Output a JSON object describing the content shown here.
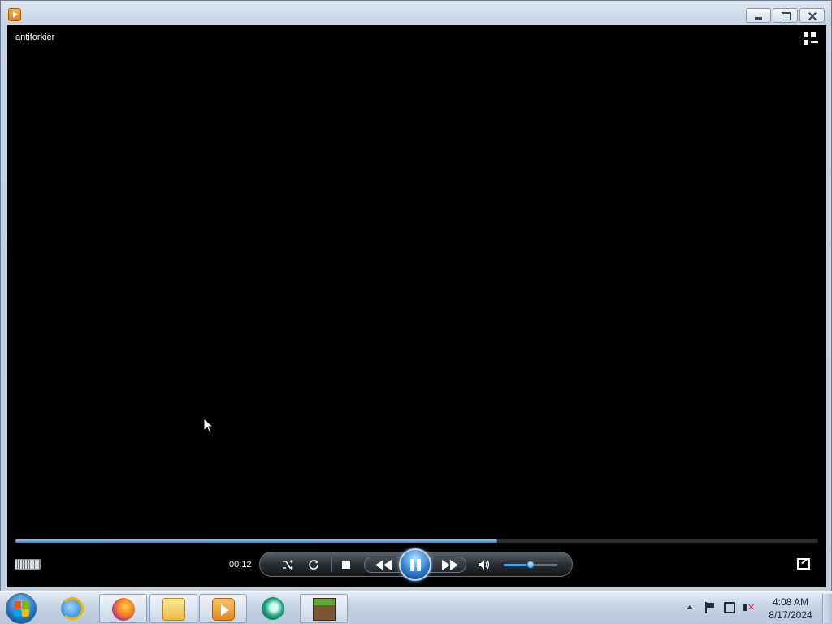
{
  "window": {
    "title_icon": "media-player-icon",
    "buttons": [
      "minimize",
      "restore",
      "close"
    ]
  },
  "player": {
    "media_title": "antiforkier",
    "elapsed_time": "00:12",
    "seek_progress_fraction": 0.6,
    "volume_fraction": 0.5,
    "state": "playing",
    "accent_color": "#3c86c9"
  },
  "controls": [
    "shuffle",
    "repeat",
    "stop",
    "previous",
    "play-pause",
    "next",
    "mute",
    "volume",
    "fullscreen"
  ],
  "taskbar": {
    "pinned": [
      "start",
      "internet-explorer",
      "firefox",
      "file-explorer",
      "windows-media-player",
      "app",
      "minecraft"
    ],
    "clock": {
      "time": "4:08 AM",
      "date": "8/17/2024"
    }
  }
}
